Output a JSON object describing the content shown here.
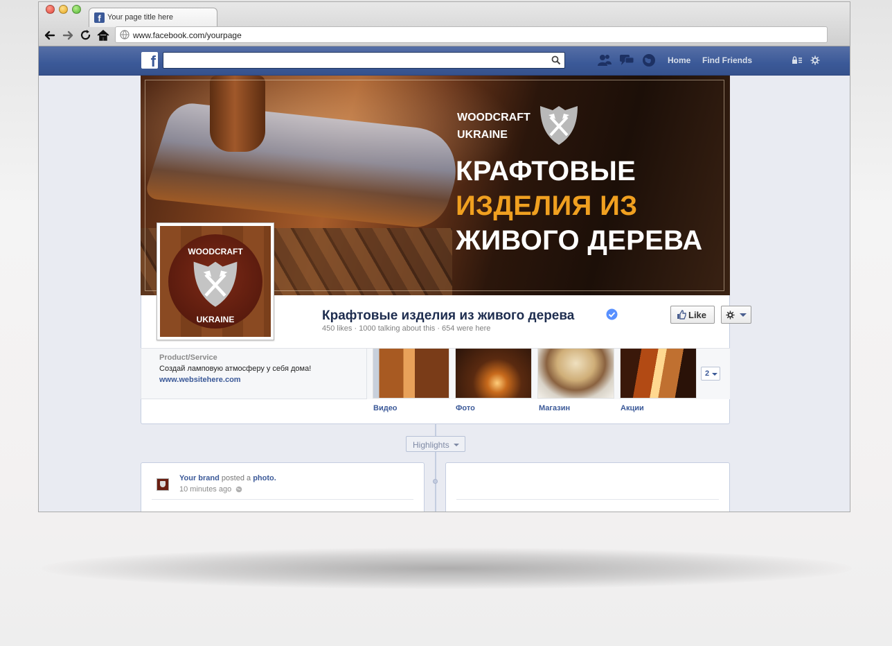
{
  "browser": {
    "tab_title": "Your page title here",
    "url": "www.facebook.com/yourpage"
  },
  "fb_nav": {
    "search_placeholder": "",
    "home_label": "Home",
    "find_friends_label": "Find Friends"
  },
  "cover": {
    "brand_line1": "WOODCRAFT",
    "brand_line2": "UKRAINE",
    "headline_line1": "КРАФТОВЫЕ",
    "headline_line2": "ИЗДЕЛИЯ ИЗ",
    "headline_line3": "ЖИВОГО ДЕРЕВА",
    "headline_accent_color": "#f0a020"
  },
  "profile": {
    "top_text": "WOODCRAFT",
    "bottom_text": "UKRAINE"
  },
  "page": {
    "name": "Крафтовые изделия из живого дерева",
    "stats": "450 likes · 1000 talking about this · 654 were here",
    "like_label": "Like"
  },
  "about": {
    "category": "Product/Service",
    "description": "Создай ламповую атмосферу у себя дома!",
    "website": "www.websitehere.com"
  },
  "apps": [
    {
      "label": "Видео",
      "icon": "lamp-photo"
    },
    {
      "label": "Фото",
      "icon": "lamp-photo"
    },
    {
      "label": "Магазин",
      "icon": "lamp-photo"
    },
    {
      "label": "Акции",
      "icon": "lamp-photo"
    }
  ],
  "apps_more_count": "2",
  "timeline": {
    "highlights_label": "Highlights"
  },
  "post": {
    "author": "Your brand",
    "action": "posted a",
    "object": "photo.",
    "time": "10 minutes ago"
  },
  "colors": {
    "facebook_blue": "#3b5998",
    "link_blue": "#3b5998"
  }
}
